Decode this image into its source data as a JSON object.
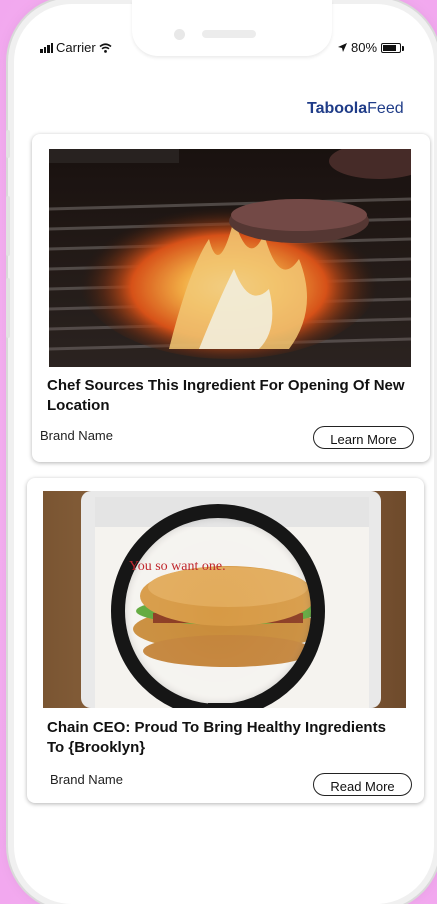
{
  "status_bar": {
    "carrier": "Carrier",
    "battery": "80%"
  },
  "feed_brand": {
    "part1": "Taboola",
    "part2": "Feed"
  },
  "cards": [
    {
      "headline": "Chef Sources This Ingredient For Opening Of New Location",
      "brand": "Brand Name",
      "cta": "Learn More"
    },
    {
      "headline": "Chain CEO: Proud To Bring Healthy Ingredients To {Brooklyn}",
      "brand": "Brand Name",
      "cta": "Read More"
    }
  ],
  "colors": {
    "background": "#f5b0f1",
    "logo": "#1f3c88"
  },
  "icons": [
    "signal-icon",
    "wifi-icon",
    "location-arrow-icon",
    "battery-icon"
  ]
}
